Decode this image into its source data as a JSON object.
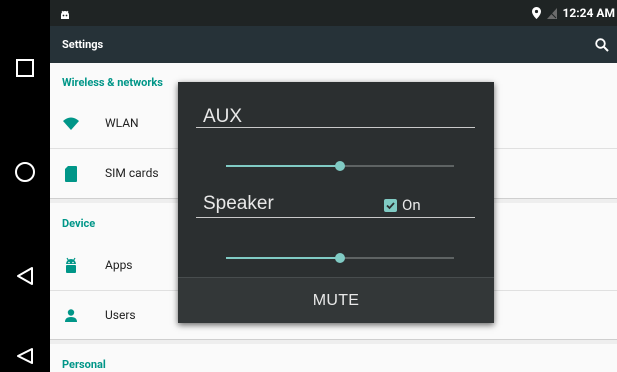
{
  "status_bar": {
    "time": "12:24 AM",
    "app_icon": "android-notification-icon",
    "location_icon": "location-pin-icon",
    "signal_icon": "no-signal-icon"
  },
  "action_bar": {
    "title": "Settings",
    "search_icon": "search-icon"
  },
  "sections": [
    {
      "header": "Wireless & networks",
      "items": [
        {
          "label": "WLAN",
          "icon": "wifi-icon"
        },
        {
          "label": "SIM cards",
          "icon": "sim-card-icon"
        }
      ]
    },
    {
      "header": "Device",
      "items": [
        {
          "label": "Apps",
          "icon": "android-icon"
        },
        {
          "label": "Users",
          "icon": "person-icon"
        }
      ]
    },
    {
      "header": "Personal",
      "items": []
    }
  ],
  "nav_buttons": [
    "recents-square-icon",
    "home-circle-icon",
    "back-triangle-icon",
    "back-outline-icon"
  ],
  "dialog": {
    "aux_title": "AUX",
    "aux_volume_percent": 50,
    "speaker_title": "Speaker",
    "speaker_on_label": "On",
    "speaker_on_checked": true,
    "speaker_volume_percent": 50,
    "mute_button": "MUTE"
  },
  "colors": {
    "accent": "#009688",
    "slider_accent": "#80cbc4",
    "action_bar": "#263238",
    "dialog_bg": "#2b2f30"
  }
}
